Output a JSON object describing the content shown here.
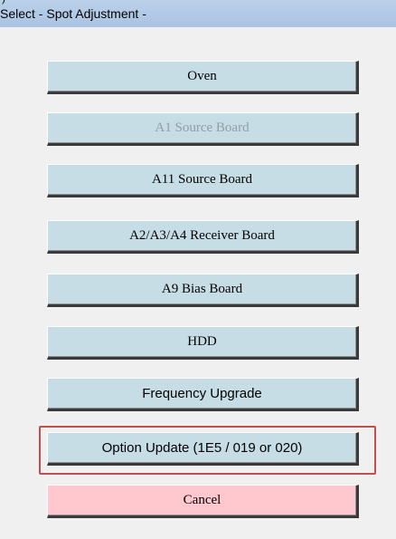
{
  "window": {
    "title": "Select - Spot Adjustment -",
    "corner_glyph": ")"
  },
  "buttons": [
    {
      "label": "Oven",
      "state": "enabled"
    },
    {
      "label": "A1 Source Board",
      "state": "disabled"
    },
    {
      "label": "A11 Source Board",
      "state": "enabled"
    },
    {
      "label": "A2/A3/A4 Receiver Board",
      "state": "enabled"
    },
    {
      "label": "A9 Bias Board",
      "state": "enabled"
    },
    {
      "label": "HDD",
      "state": "enabled"
    },
    {
      "label": "Frequency Upgrade",
      "state": "enabled"
    },
    {
      "label": "Option Update (1E5 / 019 or 020)",
      "state": "enabled",
      "highlighted": true
    },
    {
      "label": "Cancel",
      "state": "enabled"
    }
  ],
  "colors": {
    "button_face": "#c7dde6",
    "cancel_face": "#ffc8cf",
    "highlight_border": "#c0504d",
    "disabled_text": "#8f9ea5"
  }
}
